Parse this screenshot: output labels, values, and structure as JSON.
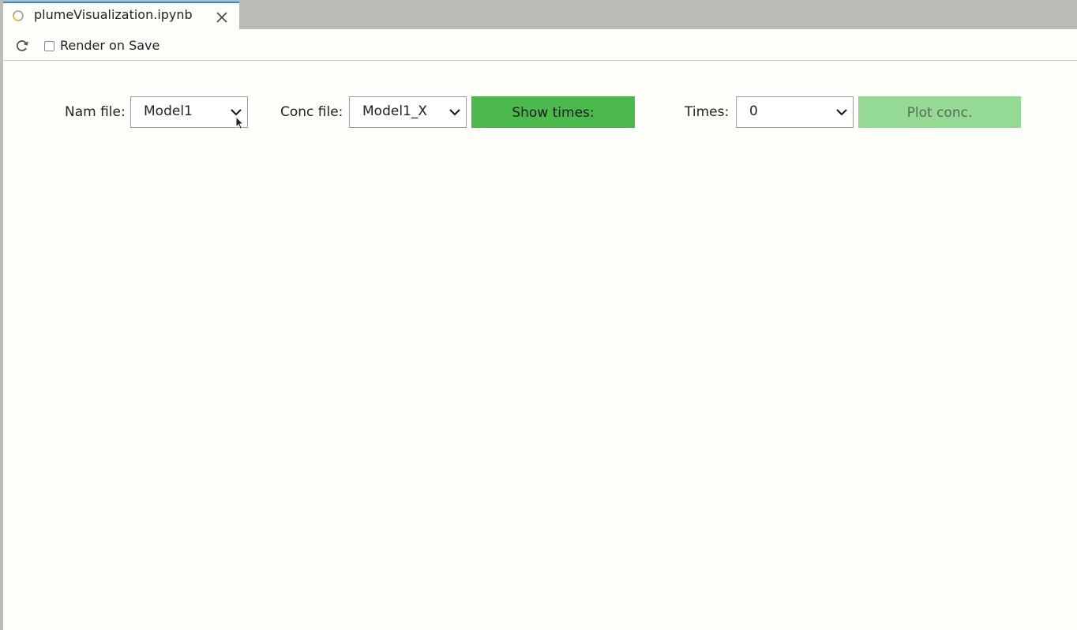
{
  "tab": {
    "title": "plumeVisualization.ipynb",
    "icons": {
      "status": "loading-spinner-icon",
      "close": "close-icon"
    }
  },
  "toolbar": {
    "refresh_icon": "refresh-icon",
    "render_on_save": {
      "label": "Render on Save",
      "checked": false
    }
  },
  "widgets": {
    "nam_file": {
      "label": "Nam file:",
      "value": "Model1"
    },
    "conc_file": {
      "label": "Conc file:",
      "value": "Model1_X"
    },
    "show_times_button": {
      "label": "Show times:"
    },
    "times": {
      "label": "Times:",
      "value": "0"
    },
    "plot_conc_button": {
      "label": "Plot conc.",
      "enabled": false
    }
  },
  "colors": {
    "accent_tab": "#2f8ce0",
    "button_primary": "#4cb94c",
    "button_disabled": "#94d994",
    "background": "#fefefb",
    "tabbar": "#bcbcb7"
  }
}
